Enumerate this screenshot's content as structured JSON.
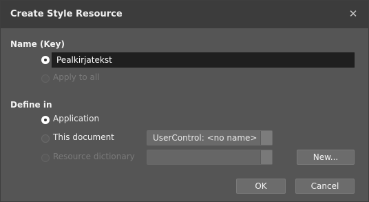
{
  "dialog": {
    "title": "Create Style Resource",
    "close_icon": "close-icon"
  },
  "name_section": {
    "label": "Name (Key)",
    "name_value": "Pealkirjatekst",
    "apply_to_all_label": "Apply to all"
  },
  "define_section": {
    "label": "Define in",
    "application_label": "Application",
    "this_document_label": "This document",
    "this_document_value": "UserControl: <no name>",
    "resource_dictionary_label": "Resource dictionary",
    "resource_dictionary_value": ""
  },
  "buttons": {
    "new_label": "New...",
    "ok_label": "OK",
    "cancel_label": "Cancel"
  },
  "selected": {
    "name_mode": "name",
    "define_in": "Application"
  }
}
